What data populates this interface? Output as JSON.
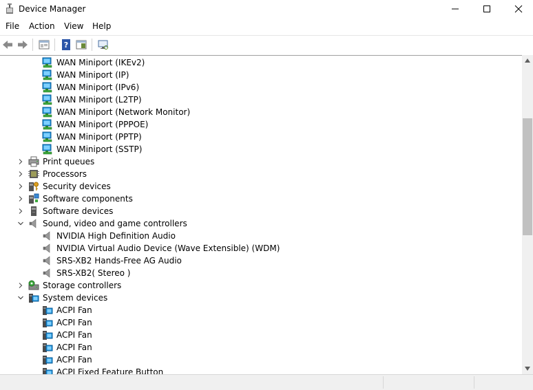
{
  "window": {
    "title": "Device Manager"
  },
  "menu": [
    "File",
    "Action",
    "View",
    "Help"
  ],
  "toolbar": [
    "back-icon",
    "forward-icon",
    "properties-icon",
    "help-icon",
    "update-driver-icon",
    "monitor-icon"
  ],
  "tree": [
    {
      "label": "WAN Miniport (IKEv2)",
      "icon": "network-adapter-icon",
      "level": 2
    },
    {
      "label": "WAN Miniport (IP)",
      "icon": "network-adapter-icon",
      "level": 2
    },
    {
      "label": "WAN Miniport (IPv6)",
      "icon": "network-adapter-icon",
      "level": 2
    },
    {
      "label": "WAN Miniport (L2TP)",
      "icon": "network-adapter-icon",
      "level": 2
    },
    {
      "label": "WAN Miniport (Network Monitor)",
      "icon": "network-adapter-icon",
      "level": 2
    },
    {
      "label": "WAN Miniport (PPPOE)",
      "icon": "network-adapter-icon",
      "level": 2
    },
    {
      "label": "WAN Miniport (PPTP)",
      "icon": "network-adapter-icon",
      "level": 2
    },
    {
      "label": "WAN Miniport (SSTP)",
      "icon": "network-adapter-icon",
      "level": 2
    },
    {
      "label": "Print queues",
      "icon": "printer-icon",
      "level": 1,
      "expander": "collapsed"
    },
    {
      "label": "Processors",
      "icon": "processor-icon",
      "level": 1,
      "expander": "collapsed"
    },
    {
      "label": "Security devices",
      "icon": "security-device-icon",
      "level": 1,
      "expander": "collapsed"
    },
    {
      "label": "Software components",
      "icon": "software-component-icon",
      "level": 1,
      "expander": "collapsed"
    },
    {
      "label": "Software devices",
      "icon": "software-device-icon",
      "level": 1,
      "expander": "collapsed"
    },
    {
      "label": "Sound, video and game controllers",
      "icon": "speaker-icon",
      "level": 1,
      "expander": "expanded"
    },
    {
      "label": "NVIDIA High Definition Audio",
      "icon": "speaker-icon",
      "level": 2
    },
    {
      "label": "NVIDIA Virtual Audio Device (Wave Extensible) (WDM)",
      "icon": "speaker-icon",
      "level": 2
    },
    {
      "label": "SRS-XB2 Hands-Free AG Audio",
      "icon": "speaker-icon",
      "level": 2
    },
    {
      "label": "SRS-XB2( Stereo )",
      "icon": "speaker-icon",
      "level": 2
    },
    {
      "label": "Storage controllers",
      "icon": "storage-controller-icon",
      "level": 1,
      "expander": "collapsed"
    },
    {
      "label": "System devices",
      "icon": "system-device-icon",
      "level": 1,
      "expander": "expanded"
    },
    {
      "label": "ACPI Fan",
      "icon": "system-device-icon",
      "level": 2
    },
    {
      "label": "ACPI Fan",
      "icon": "system-device-icon",
      "level": 2
    },
    {
      "label": "ACPI Fan",
      "icon": "system-device-icon",
      "level": 2
    },
    {
      "label": "ACPI Fan",
      "icon": "system-device-icon",
      "level": 2
    },
    {
      "label": "ACPI Fan",
      "icon": "system-device-icon",
      "level": 2
    },
    {
      "label": "ACPI Fixed Feature Button",
      "icon": "system-device-icon",
      "level": 2
    }
  ]
}
